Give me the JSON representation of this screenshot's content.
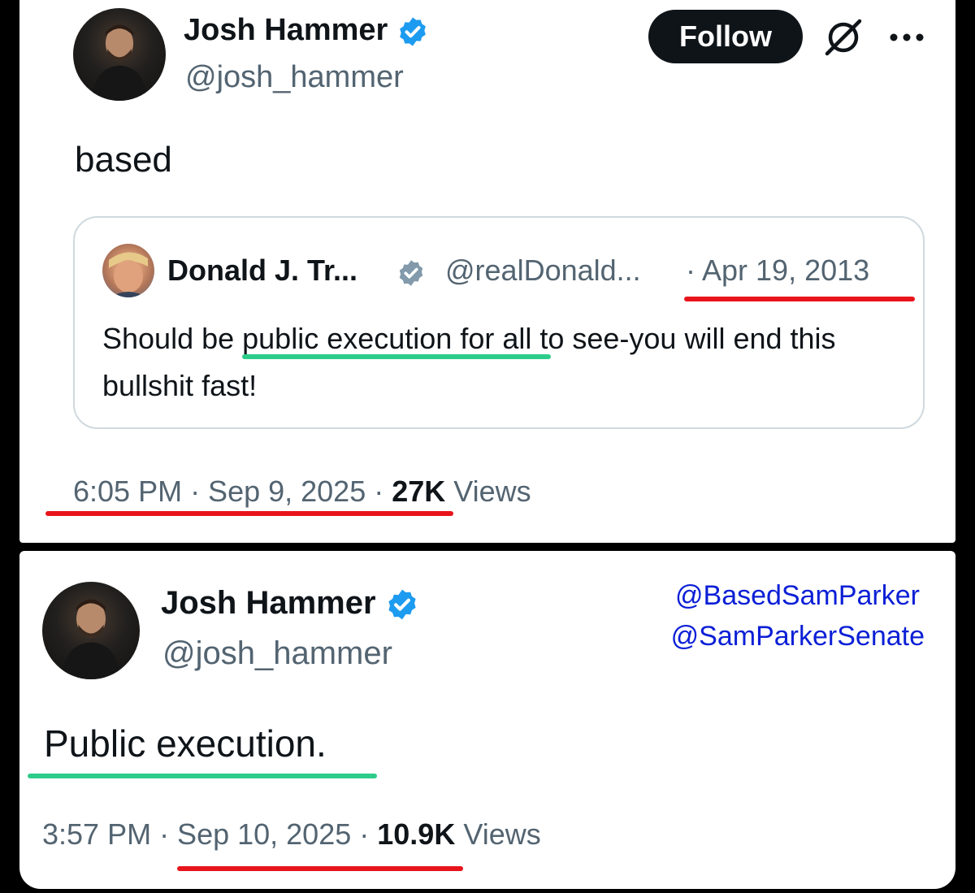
{
  "tweet1": {
    "author_name": "Josh Hammer",
    "author_handle": "@josh_hammer",
    "follow_label": "Follow",
    "text": "based",
    "quoted": {
      "author_name": "Donald J. Tr...",
      "author_handle": "@realDonald...",
      "date": "· Apr 19, 2013",
      "text": "Should be public execution for all to see-you will end this bullshit fast!"
    },
    "timestamp": "6:05 PM · Sep 9, 2025 · ",
    "views_count": "27K",
    "views_label": " Views"
  },
  "tweet2": {
    "author_name": "Josh Hammer",
    "author_handle": "@josh_hammer",
    "text": "Public execution.",
    "timestamp": "3:57 PM · Sep 10, 2025 · ",
    "views_count": "10.9K",
    "views_label": " Views"
  },
  "overlay_handles": [
    "@BasedSamParker",
    "@SamParkerSenate"
  ],
  "colors": {
    "verified_badge": "#1d9bf0",
    "quoted_badge": "#829aab",
    "underline_red": "#e8141b",
    "underline_green": "#2ecc8a",
    "overlay_text": "#0b1fd6"
  },
  "icons": [
    "verified-badge-icon",
    "grok-icon",
    "more-icon"
  ]
}
